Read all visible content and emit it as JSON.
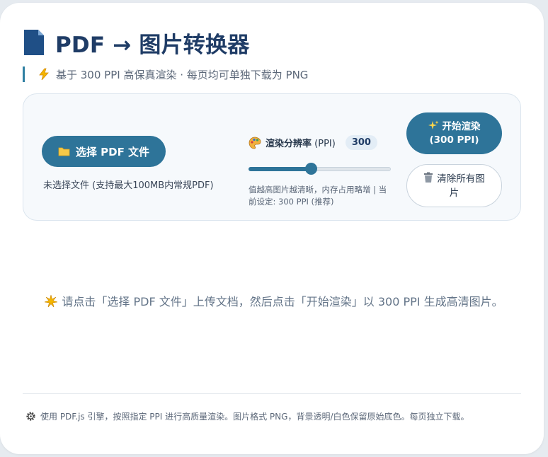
{
  "header": {
    "title": "PDF → 图片转换器",
    "subtitle": "基于 300 PPI 高保真渲染 · 每页均可单独下载为 PNG"
  },
  "controls": {
    "choose_button_label": "选择 PDF 文件",
    "file_status": "未选择文件 (支持最大100MB内常规PDF)",
    "resolution_label": "渲染分辨率",
    "resolution_unit": "(PPI)",
    "resolution_value": "300",
    "slider_fraction": 0.44,
    "hint": "值越高图片越清晰，内存占用略增 | 当前设定: 300 PPI (推荐)",
    "render_button_label": "开始渲染 (300 PPI)",
    "clear_button_label": "清除所有图片"
  },
  "empty_state": {
    "message": "请点击「选择 PDF 文件」上传文档，然后点击「开始渲染」以 300 PPI 生成高清图片。"
  },
  "footer": {
    "text": "使用 PDF.js 引擎，按照指定 PPI 进行高质量渲染。图片格式 PNG，背景透明/白色保留原始底色。每页独立下载。"
  },
  "icons": {
    "title": "document-icon",
    "subtitle": "lightning-icon",
    "choose": "folder-icon",
    "resolution": "palette-icon",
    "render": "sparkles-icon",
    "clear": "trash-icon",
    "empty": "sparkle-burst-icon",
    "footer": "gear-icon"
  },
  "colors": {
    "accent": "#2e7499",
    "title": "#1f3c66",
    "panel_bg": "#f6f9fc"
  }
}
